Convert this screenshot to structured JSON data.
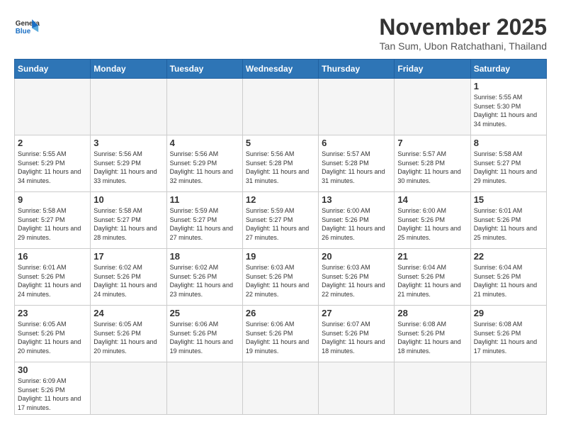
{
  "header": {
    "logo_general": "General",
    "logo_blue": "Blue",
    "month_title": "November 2025",
    "location": "Tan Sum, Ubon Ratchathani, Thailand"
  },
  "days_of_week": [
    "Sunday",
    "Monday",
    "Tuesday",
    "Wednesday",
    "Thursday",
    "Friday",
    "Saturday"
  ],
  "weeks": [
    [
      {
        "day": "",
        "info": ""
      },
      {
        "day": "",
        "info": ""
      },
      {
        "day": "",
        "info": ""
      },
      {
        "day": "",
        "info": ""
      },
      {
        "day": "",
        "info": ""
      },
      {
        "day": "",
        "info": ""
      },
      {
        "day": "1",
        "info": "Sunrise: 5:55 AM\nSunset: 5:30 PM\nDaylight: 11 hours\nand 34 minutes."
      }
    ],
    [
      {
        "day": "2",
        "info": "Sunrise: 5:55 AM\nSunset: 5:29 PM\nDaylight: 11 hours\nand 34 minutes."
      },
      {
        "day": "3",
        "info": "Sunrise: 5:56 AM\nSunset: 5:29 PM\nDaylight: 11 hours\nand 33 minutes."
      },
      {
        "day": "4",
        "info": "Sunrise: 5:56 AM\nSunset: 5:29 PM\nDaylight: 11 hours\nand 32 minutes."
      },
      {
        "day": "5",
        "info": "Sunrise: 5:56 AM\nSunset: 5:28 PM\nDaylight: 11 hours\nand 31 minutes."
      },
      {
        "day": "6",
        "info": "Sunrise: 5:57 AM\nSunset: 5:28 PM\nDaylight: 11 hours\nand 31 minutes."
      },
      {
        "day": "7",
        "info": "Sunrise: 5:57 AM\nSunset: 5:28 PM\nDaylight: 11 hours\nand 30 minutes."
      },
      {
        "day": "8",
        "info": "Sunrise: 5:58 AM\nSunset: 5:27 PM\nDaylight: 11 hours\nand 29 minutes."
      }
    ],
    [
      {
        "day": "9",
        "info": "Sunrise: 5:58 AM\nSunset: 5:27 PM\nDaylight: 11 hours\nand 29 minutes."
      },
      {
        "day": "10",
        "info": "Sunrise: 5:58 AM\nSunset: 5:27 PM\nDaylight: 11 hours\nand 28 minutes."
      },
      {
        "day": "11",
        "info": "Sunrise: 5:59 AM\nSunset: 5:27 PM\nDaylight: 11 hours\nand 27 minutes."
      },
      {
        "day": "12",
        "info": "Sunrise: 5:59 AM\nSunset: 5:27 PM\nDaylight: 11 hours\nand 27 minutes."
      },
      {
        "day": "13",
        "info": "Sunrise: 6:00 AM\nSunset: 5:26 PM\nDaylight: 11 hours\nand 26 minutes."
      },
      {
        "day": "14",
        "info": "Sunrise: 6:00 AM\nSunset: 5:26 PM\nDaylight: 11 hours\nand 25 minutes."
      },
      {
        "day": "15",
        "info": "Sunrise: 6:01 AM\nSunset: 5:26 PM\nDaylight: 11 hours\nand 25 minutes."
      }
    ],
    [
      {
        "day": "16",
        "info": "Sunrise: 6:01 AM\nSunset: 5:26 PM\nDaylight: 11 hours\nand 24 minutes."
      },
      {
        "day": "17",
        "info": "Sunrise: 6:02 AM\nSunset: 5:26 PM\nDaylight: 11 hours\nand 24 minutes."
      },
      {
        "day": "18",
        "info": "Sunrise: 6:02 AM\nSunset: 5:26 PM\nDaylight: 11 hours\nand 23 minutes."
      },
      {
        "day": "19",
        "info": "Sunrise: 6:03 AM\nSunset: 5:26 PM\nDaylight: 11 hours\nand 22 minutes."
      },
      {
        "day": "20",
        "info": "Sunrise: 6:03 AM\nSunset: 5:26 PM\nDaylight: 11 hours\nand 22 minutes."
      },
      {
        "day": "21",
        "info": "Sunrise: 6:04 AM\nSunset: 5:26 PM\nDaylight: 11 hours\nand 21 minutes."
      },
      {
        "day": "22",
        "info": "Sunrise: 6:04 AM\nSunset: 5:26 PM\nDaylight: 11 hours\nand 21 minutes."
      }
    ],
    [
      {
        "day": "23",
        "info": "Sunrise: 6:05 AM\nSunset: 5:26 PM\nDaylight: 11 hours\nand 20 minutes."
      },
      {
        "day": "24",
        "info": "Sunrise: 6:05 AM\nSunset: 5:26 PM\nDaylight: 11 hours\nand 20 minutes."
      },
      {
        "day": "25",
        "info": "Sunrise: 6:06 AM\nSunset: 5:26 PM\nDaylight: 11 hours\nand 19 minutes."
      },
      {
        "day": "26",
        "info": "Sunrise: 6:06 AM\nSunset: 5:26 PM\nDaylight: 11 hours\nand 19 minutes."
      },
      {
        "day": "27",
        "info": "Sunrise: 6:07 AM\nSunset: 5:26 PM\nDaylight: 11 hours\nand 18 minutes."
      },
      {
        "day": "28",
        "info": "Sunrise: 6:08 AM\nSunset: 5:26 PM\nDaylight: 11 hours\nand 18 minutes."
      },
      {
        "day": "29",
        "info": "Sunrise: 6:08 AM\nSunset: 5:26 PM\nDaylight: 11 hours\nand 17 minutes."
      }
    ],
    [
      {
        "day": "30",
        "info": "Sunrise: 6:09 AM\nSunset: 5:26 PM\nDaylight: 11 hours\nand 17 minutes."
      },
      {
        "day": "",
        "info": ""
      },
      {
        "day": "",
        "info": ""
      },
      {
        "day": "",
        "info": ""
      },
      {
        "day": "",
        "info": ""
      },
      {
        "day": "",
        "info": ""
      },
      {
        "day": "",
        "info": ""
      }
    ]
  ]
}
